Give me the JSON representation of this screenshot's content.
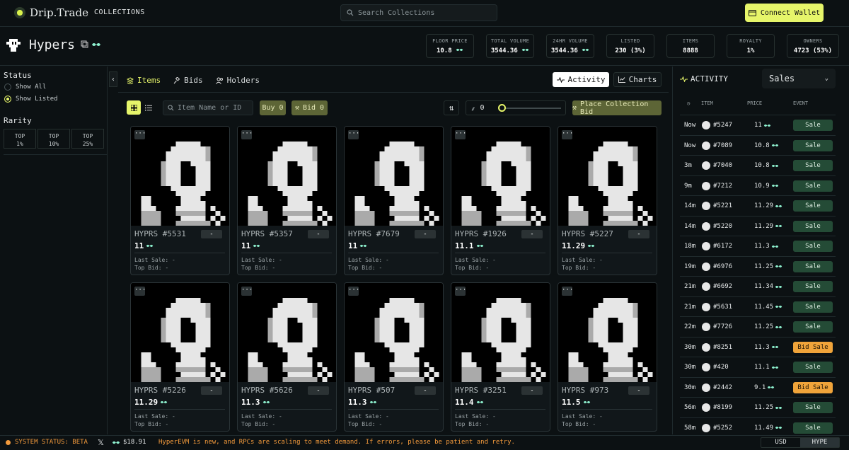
{
  "nav": {
    "brand": "Drip.Trade",
    "collections": "COLLECTIONS",
    "search_placeholder": "Search Collections",
    "connect": "Connect Wallet"
  },
  "collection": {
    "name": "Hypers"
  },
  "stats": [
    {
      "label": "FLOOR PRICE",
      "value": "10.8",
      "hype": true
    },
    {
      "label": "TOTAL VOLUME",
      "value": "3544.36",
      "hype": true
    },
    {
      "label": "24HR VOLUME",
      "value": "3544.36",
      "hype": true
    },
    {
      "label": "LISTED",
      "value": "230 (3%)"
    },
    {
      "label": "ITEMS",
      "value": "8888"
    },
    {
      "label": "ROYALTY",
      "value": "1%"
    },
    {
      "label": "OWNERS",
      "value": "4723 (53%)"
    }
  ],
  "sidebar": {
    "status_title": "Status",
    "show_all": "Show All",
    "show_listed": "Show Listed",
    "rarity_title": "Rarity",
    "rarity": [
      {
        "top": "TOP",
        "pct": "1%"
      },
      {
        "top": "TOP",
        "pct": "10%"
      },
      {
        "top": "TOP",
        "pct": "25%"
      }
    ]
  },
  "tabs": {
    "items": "Items",
    "bids": "Bids",
    "holders": "Holders",
    "activity": "Activity",
    "charts": "Charts"
  },
  "toolbar": {
    "item_search_placeholder": "Item Name or ID",
    "buy": "Buy 0",
    "bid": "Bid 0",
    "sweep_value": "0",
    "place_bid": "Place Collection Bid"
  },
  "cards": [
    {
      "name": "HYPRS #5531",
      "price": "11"
    },
    {
      "name": "HYPRS #5357",
      "price": "11"
    },
    {
      "name": "HYPRS #7679",
      "price": "11"
    },
    {
      "name": "HYPRS #1926",
      "price": "11.1"
    },
    {
      "name": "HYPRS #5227",
      "price": "11.29"
    },
    {
      "name": "HYPRS #5226",
      "price": "11.29"
    },
    {
      "name": "HYPRS #5626",
      "price": "11.3"
    },
    {
      "name": "HYPRS #507",
      "price": "11.3"
    },
    {
      "name": "HYPRS #3251",
      "price": "11.4"
    },
    {
      "name": "HYPRS #973",
      "price": "11.5"
    }
  ],
  "card_labels": {
    "dash": "-",
    "last_sale": "Last Sale: -",
    "top_bid": "Top Bid: -",
    "menu": "···"
  },
  "activity": {
    "title": "ACTIVITY",
    "filter": "Sales",
    "headers": {
      "item": "ITEM",
      "price": "PRICE",
      "event": "EVENT"
    },
    "rows": [
      {
        "time": "Now",
        "id": "#5247",
        "price": "11",
        "event": "Sale"
      },
      {
        "time": "Now",
        "id": "#7089",
        "price": "10.8",
        "event": "Sale"
      },
      {
        "time": "3m",
        "id": "#7040",
        "price": "10.8",
        "event": "Sale"
      },
      {
        "time": "9m",
        "id": "#7212",
        "price": "10.9",
        "event": "Sale"
      },
      {
        "time": "14m",
        "id": "#5221",
        "price": "11.29",
        "event": "Sale"
      },
      {
        "time": "14m",
        "id": "#5220",
        "price": "11.29",
        "event": "Sale"
      },
      {
        "time": "18m",
        "id": "#6172",
        "price": "11.3",
        "event": "Sale"
      },
      {
        "time": "19m",
        "id": "#6976",
        "price": "11.25",
        "event": "Sale"
      },
      {
        "time": "21m",
        "id": "#6692",
        "price": "11.34",
        "event": "Sale"
      },
      {
        "time": "21m",
        "id": "#5631",
        "price": "11.45",
        "event": "Sale"
      },
      {
        "time": "22m",
        "id": "#7726",
        "price": "11.25",
        "event": "Sale"
      },
      {
        "time": "30m",
        "id": "#8251",
        "price": "11.3",
        "event": "Bid Sale"
      },
      {
        "time": "30m",
        "id": "#420",
        "price": "11.1",
        "event": "Sale"
      },
      {
        "time": "30m",
        "id": "#2442",
        "price": "9.1",
        "event": "Bid Sale"
      },
      {
        "time": "56m",
        "id": "#8199",
        "price": "11.25",
        "event": "Sale"
      },
      {
        "time": "58m",
        "id": "#5252",
        "price": "11.49",
        "event": "Sale"
      }
    ]
  },
  "footer": {
    "status": "SYSTEM STATUS: BETA",
    "x": "𝕏",
    "price": "$18.91",
    "message": "HyperEVM is new, and RPCs are scaling to meet demand. If errors, please be patient and retry.",
    "usd": "USD",
    "hype": "HYPE"
  },
  "colors": {
    "accent": "#e6f56a",
    "sale": "#244b36",
    "bid_sale": "#f0a43a",
    "hype": "#8ff2d0"
  }
}
